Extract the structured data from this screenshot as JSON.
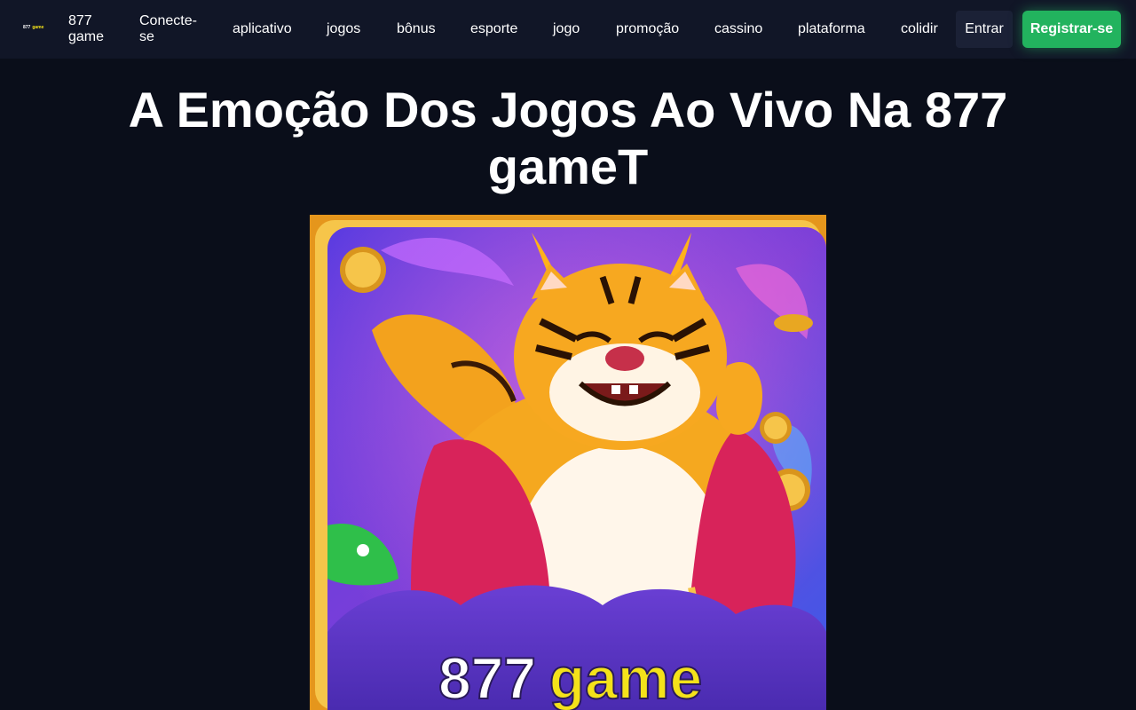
{
  "header": {
    "logo_primary": "877",
    "logo_secondary": "game",
    "nav": [
      {
        "label": "877 game"
      },
      {
        "label": "Conecte-se"
      },
      {
        "label": "aplicativo"
      },
      {
        "label": "jogos"
      },
      {
        "label": "bônus"
      },
      {
        "label": "esporte"
      },
      {
        "label": "jogo"
      },
      {
        "label": "promoção"
      },
      {
        "label": "cassino"
      },
      {
        "label": "plataforma"
      },
      {
        "label": "colidir"
      }
    ],
    "login_label": "Entrar",
    "register_label": "Registrar-se"
  },
  "main": {
    "title": "A Emoção Dos Jogos Ao Vivo Na 877 gameT",
    "hero": {
      "caption_primary": "877",
      "caption_secondary": "game",
      "icon": "tiger-mascot-image"
    }
  },
  "colors": {
    "background": "#0a0e1a",
    "header": "#111627",
    "register_button": "#22b35e",
    "accent_yellow": "#f4e21a"
  }
}
